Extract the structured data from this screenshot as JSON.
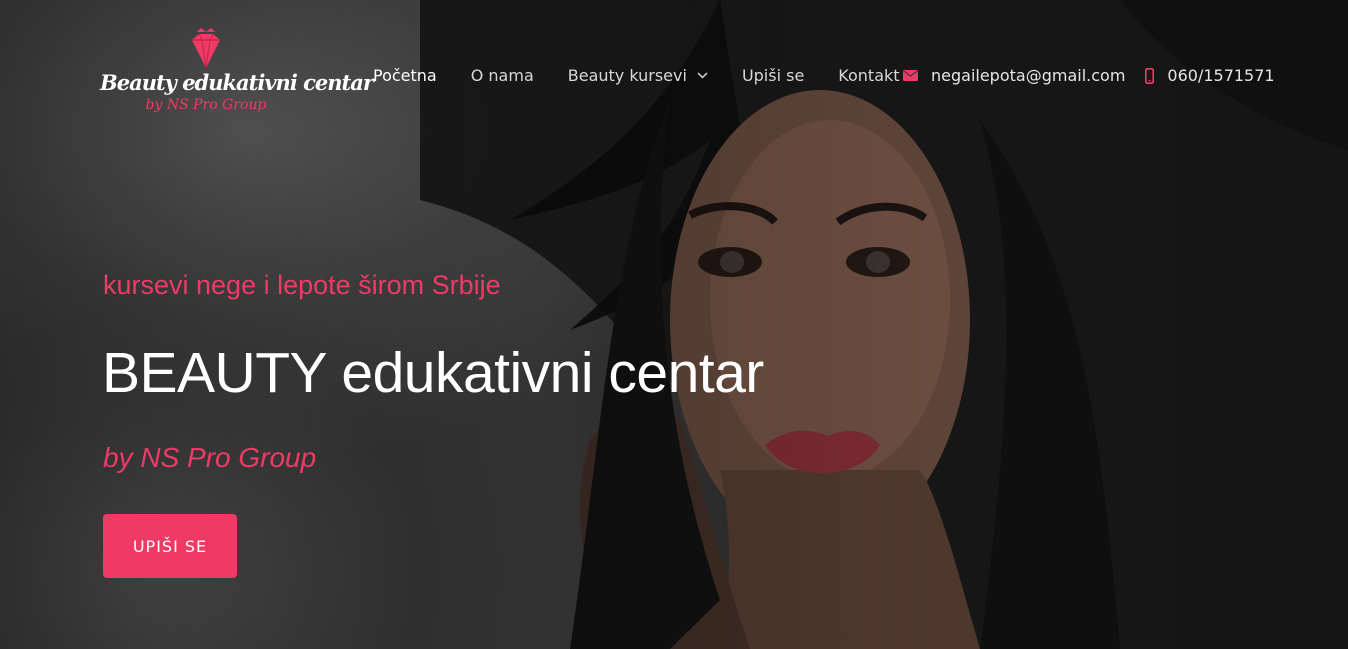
{
  "brand": {
    "title": "Beauty edukativni centar",
    "subtitle": "by NS Pro Group",
    "gem_icon": "diamond-icon",
    "accent_color": "#ef3a65"
  },
  "nav": {
    "items": [
      {
        "label": "Početna",
        "active": true
      },
      {
        "label": "O nama"
      },
      {
        "label": "Beauty kursevi",
        "has_dropdown": true
      },
      {
        "label": "Upiši se"
      },
      {
        "label": "Kontakt"
      }
    ]
  },
  "contact": {
    "email": "negailepota@gmail.com",
    "email_icon": "envelope-icon",
    "phone": "060/1571571",
    "phone_icon": "mobile-phone-icon"
  },
  "hero": {
    "tagline": "kursevi nege i lepote širom Srbije",
    "headline": "BEAUTY edukativni centar",
    "byline": "by NS Pro Group",
    "cta_label": "UPIŠI SE"
  }
}
